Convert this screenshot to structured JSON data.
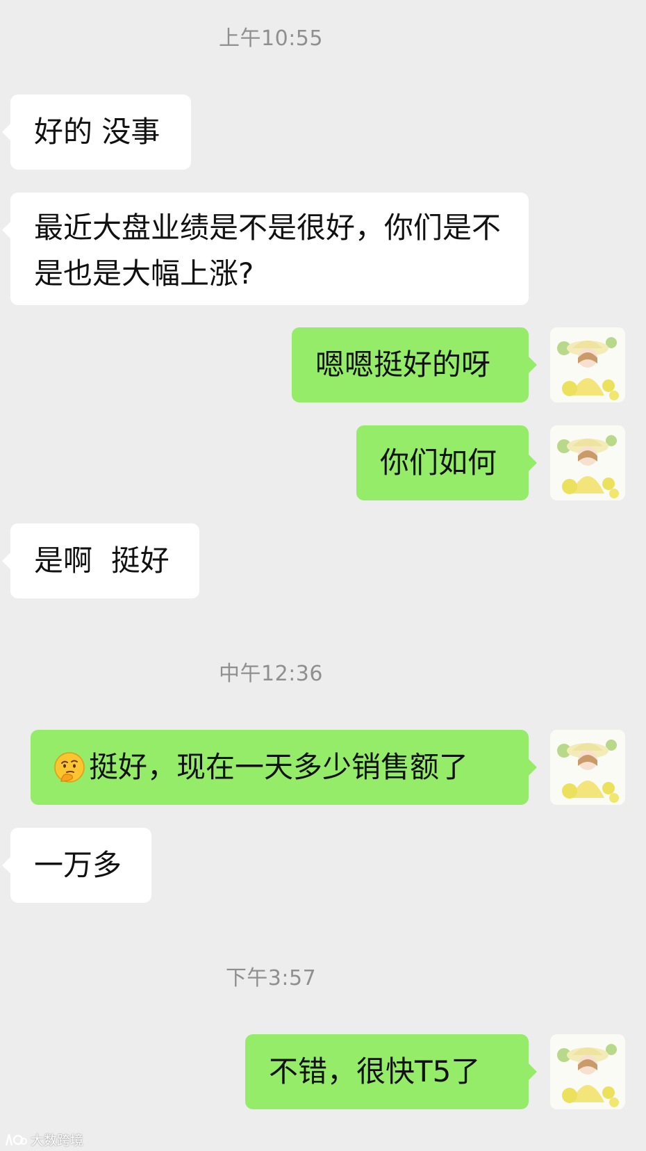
{
  "messages": [
    {
      "type": "time",
      "text": "上午10:55"
    },
    {
      "type": "msg",
      "side": "left",
      "text": "好的 没事"
    },
    {
      "type": "msg",
      "side": "left",
      "text": "最近大盘业绩是不是很好，你们是不是也是大幅上涨?"
    },
    {
      "type": "msg",
      "side": "right",
      "text": "嗯嗯挺好的呀",
      "avatar": "girl-with-lemons-avatar"
    },
    {
      "type": "msg",
      "side": "right",
      "text": "你们如何",
      "avatar": "girl-with-lemons-avatar"
    },
    {
      "type": "msg",
      "side": "left",
      "text": "是啊  挺好"
    },
    {
      "type": "time",
      "text": "中午12:36"
    },
    {
      "type": "msg",
      "side": "right",
      "emoji": "thinking-face-emoji",
      "text": "挺好，现在一天多少销售额了",
      "avatar": "girl-with-lemons-avatar"
    },
    {
      "type": "msg",
      "side": "left",
      "text": "一万多"
    },
    {
      "type": "time",
      "text": "下午3:57"
    },
    {
      "type": "msg",
      "side": "right",
      "text": "不错，很快T5了",
      "avatar": "girl-with-lemons-avatar"
    }
  ],
  "watermark": {
    "text": "大数跨境",
    "icon": "logo-icon"
  },
  "colors": {
    "background": "#ededed",
    "sent_bubble": "#95ec69",
    "received_bubble": "#ffffff",
    "timestamp_text": "#8f8f8f"
  }
}
